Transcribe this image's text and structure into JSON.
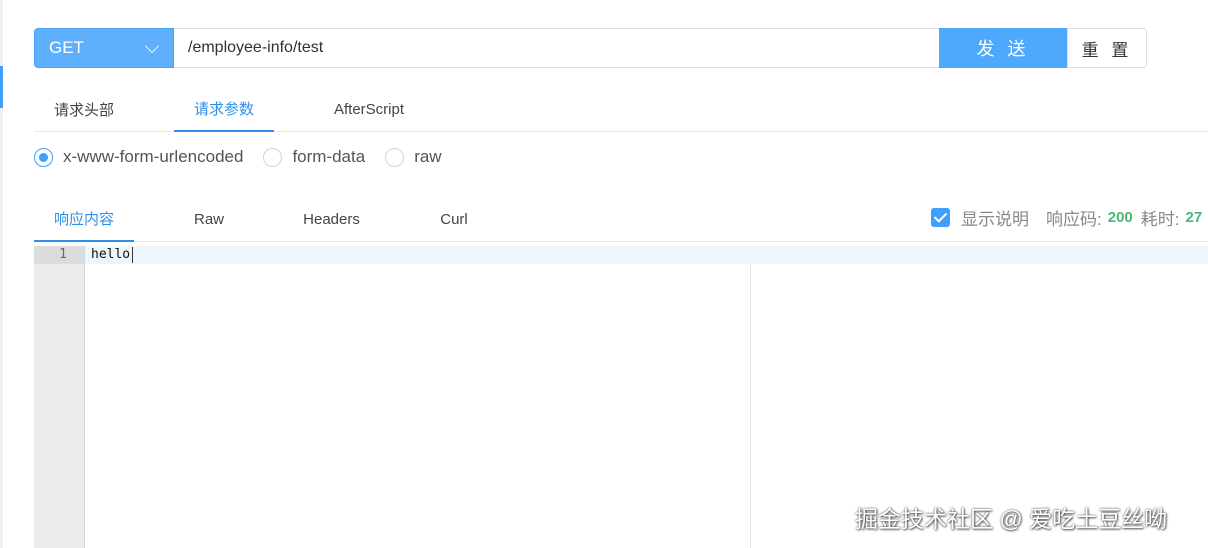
{
  "request": {
    "method": "GET",
    "url": "/employee-info/test",
    "send_label": "发 送",
    "reset_label": "重 置"
  },
  "request_tabs": [
    {
      "label": "请求头部",
      "active": false
    },
    {
      "label": "请求参数",
      "active": true
    },
    {
      "label": "AfterScript",
      "active": false
    }
  ],
  "body_types": [
    {
      "label": "x-www-form-urlencoded",
      "checked": true
    },
    {
      "label": "form-data",
      "checked": false
    },
    {
      "label": "raw",
      "checked": false
    }
  ],
  "response_tabs": [
    {
      "label": "响应内容",
      "active": true
    },
    {
      "label": "Raw",
      "active": false
    },
    {
      "label": "Headers",
      "active": false
    },
    {
      "label": "Curl",
      "active": false
    }
  ],
  "response_info": {
    "show_description_label": "显示说明",
    "show_description_checked": true,
    "status_code_label": "响应码:",
    "status_code": "200",
    "time_label": "耗时:",
    "time_value": "27"
  },
  "editor": {
    "line_number": "1",
    "content": "hello"
  },
  "watermark": "掘金技术社区 @ 爱吃土豆丝呦",
  "colors": {
    "accent": "#409eff",
    "success": "#48b876"
  }
}
